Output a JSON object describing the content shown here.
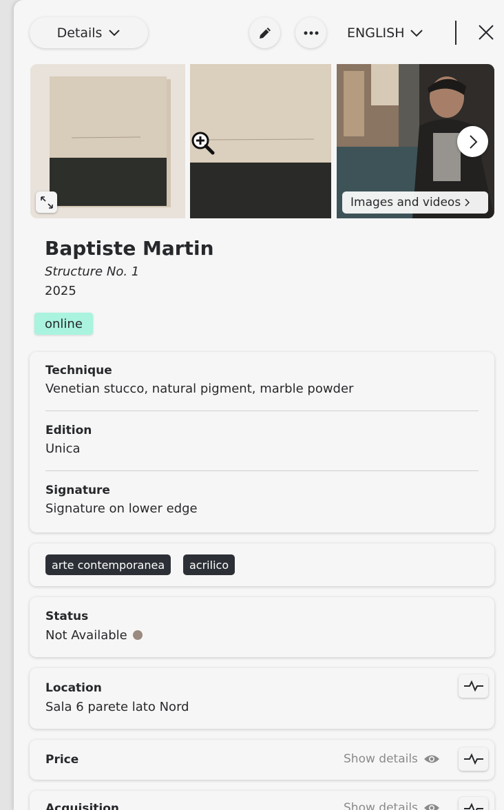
{
  "header": {
    "details_label": "Details",
    "language_label": "ENGLISH"
  },
  "gallery": {
    "media_label": "Images and videos"
  },
  "artwork": {
    "artist": "Baptiste Martin",
    "title": "Structure No. 1",
    "year": "2025",
    "status_badge": "online"
  },
  "info_card": {
    "technique_label": "Technique",
    "technique_value": "Venetian stucco, natural pigment, marble powder",
    "edition_label": "Edition",
    "edition_value": "Unica",
    "signature_label": "Signature",
    "signature_value": "Signature on lower edge"
  },
  "tags": [
    "arte contemporanea",
    "acrilico"
  ],
  "status": {
    "label": "Status",
    "value": "Not Available",
    "dot_color": "#9a8a7f"
  },
  "location": {
    "label": "Location",
    "value": "Sala 6 parete lato Nord"
  },
  "price": {
    "label": "Price",
    "show_details": "Show details"
  },
  "acquisition": {
    "label": "Acquisition",
    "show_details": "Show details"
  },
  "colors": {
    "badge_bg": "#a9f3df",
    "tag_bg": "#2c3036",
    "panel_bg": "#f6f6f6"
  }
}
